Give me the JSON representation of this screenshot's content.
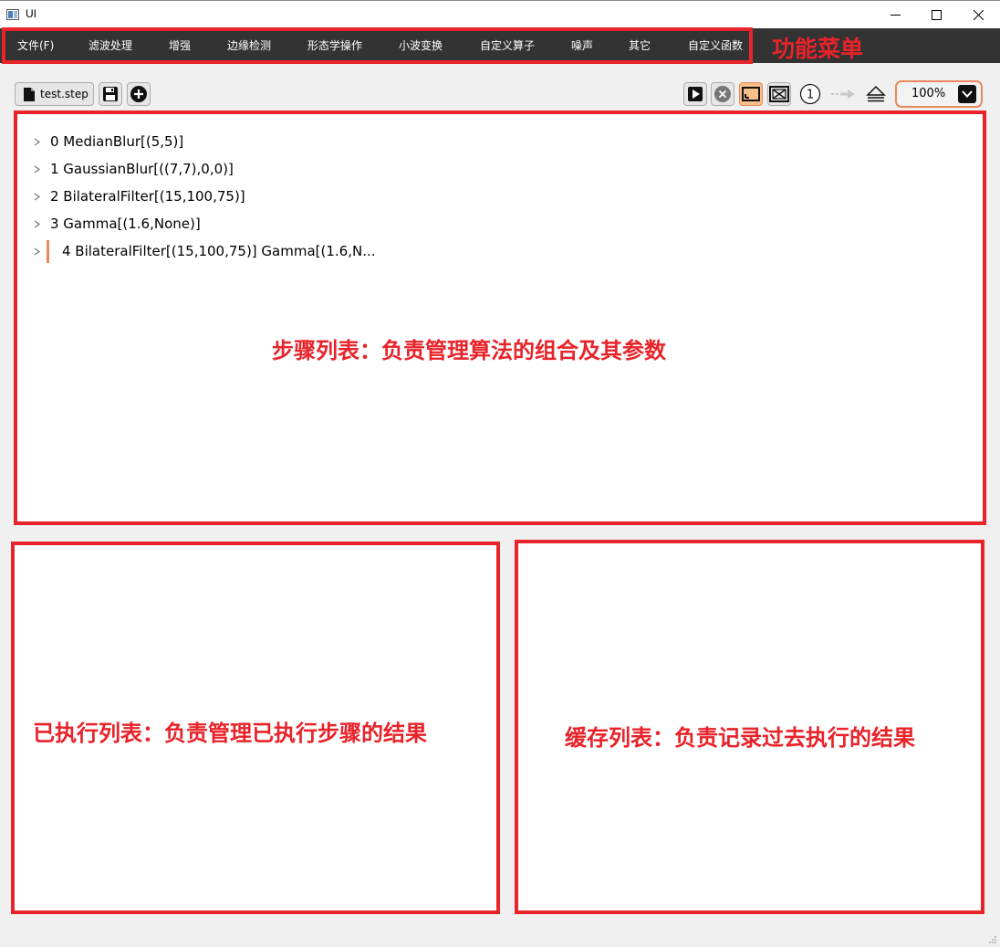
{
  "window": {
    "title": "UI"
  },
  "menu": {
    "items": [
      "文件(F)",
      "滤波处理",
      "增强",
      "边缘检测",
      "形态学操作",
      "小波变换",
      "自定义算子",
      "噪声",
      "其它",
      "自定义函数"
    ]
  },
  "annotations": {
    "menu_label": "功能菜单",
    "steps_label": "步骤列表：负责管理算法的组合及其参数",
    "executed_label": "已执行列表：负责管理已执行步骤的结果",
    "cache_label": "缓存列表：负责记录过去执行的结果"
  },
  "toolbar": {
    "file_name": "test.step",
    "zoom": "100%",
    "step_badge": "1"
  },
  "steps": [
    {
      "index": "0",
      "text": "0 MedianBlur[(5,5)]"
    },
    {
      "index": "1",
      "text": "1 GaussianBlur[((7,7),0,0)]"
    },
    {
      "index": "2",
      "text": "2 BilateralFilter[(15,100,75)]"
    },
    {
      "index": "3",
      "text": "3 Gamma[(1.6,None)]"
    },
    {
      "index": "4",
      "text": "4 BilateralFilter[(15,100,75)] Gamma[(1.6,N..."
    }
  ],
  "colors": {
    "annotation_red": "#e8232a",
    "accent_orange": "#e9885a",
    "menubar_bg": "#333333"
  }
}
